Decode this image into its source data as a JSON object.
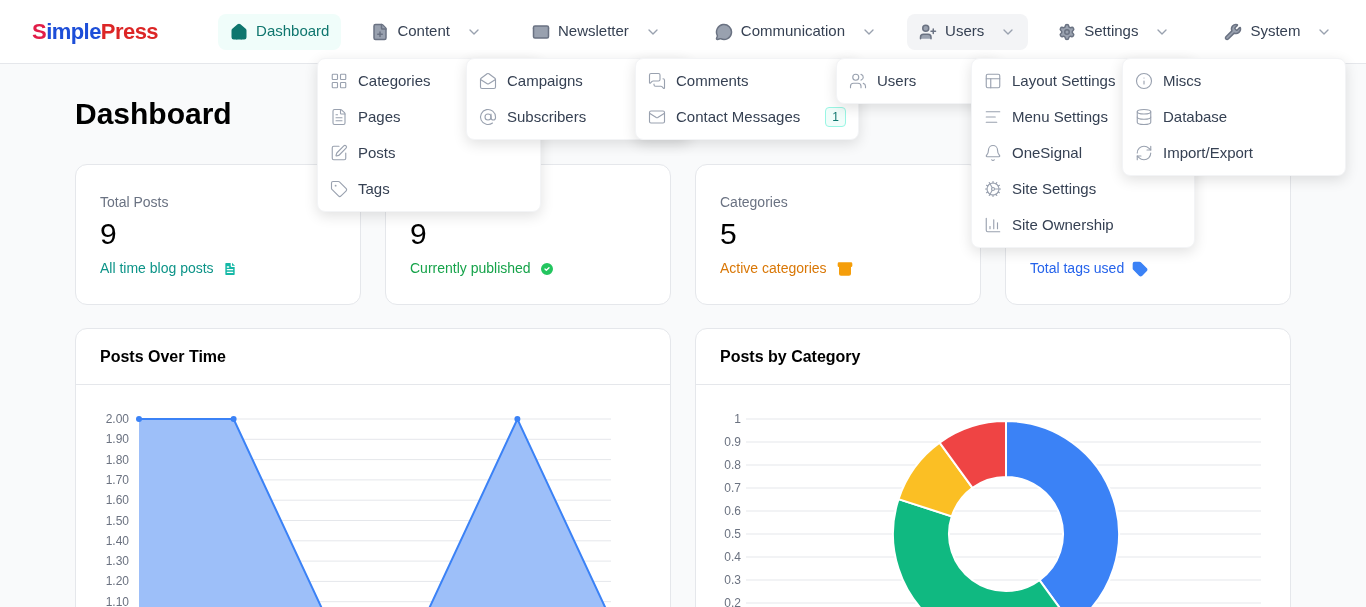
{
  "logo": [
    "S",
    "imple",
    "Press"
  ],
  "nav": [
    {
      "label": "Dashboard",
      "selected": true,
      "hovered": false
    },
    {
      "label": "Content",
      "selected": false,
      "hovered": false
    },
    {
      "label": "Newsletter",
      "selected": false,
      "hovered": false
    },
    {
      "label": "Communication",
      "selected": false,
      "hovered": false
    },
    {
      "label": "Users",
      "selected": false,
      "hovered": true
    },
    {
      "label": "Settings",
      "selected": false,
      "hovered": false
    },
    {
      "label": "System",
      "selected": false,
      "hovered": false
    }
  ],
  "menus": [
    {
      "items": [
        {
          "label": "Categories"
        },
        {
          "label": "Pages"
        },
        {
          "label": "Posts"
        },
        {
          "label": "Tags"
        }
      ]
    },
    {
      "items": [
        {
          "label": "Campaigns"
        },
        {
          "label": "Subscribers"
        }
      ]
    },
    {
      "items": [
        {
          "label": "Comments"
        },
        {
          "label": "Contact Messages",
          "badge": "1"
        }
      ]
    },
    {
      "items": [
        {
          "label": "Users"
        }
      ]
    },
    {
      "items": [
        {
          "label": "Layout Settings"
        },
        {
          "label": "Menu Settings"
        },
        {
          "label": "OneSignal"
        },
        {
          "label": "Site Settings"
        },
        {
          "label": "Site Ownership"
        }
      ]
    },
    {
      "items": [
        {
          "label": "Miscs"
        },
        {
          "label": "Database"
        },
        {
          "label": "Import/Export"
        }
      ]
    }
  ],
  "page_title": "Dashboard",
  "stats": [
    {
      "kind": "posts",
      "label": "Total Posts",
      "value": "9",
      "note": "All time blog posts"
    },
    {
      "kind": "published",
      "value": "9",
      "note": "Currently published"
    },
    {
      "kind": "categories",
      "label": "Categories",
      "value": "5",
      "note": "Active categories"
    },
    {
      "kind": "tags",
      "note": "Total tags used"
    }
  ],
  "line_chart": {
    "title": "Posts Over Time",
    "axis_labels": [
      "2.00",
      "1.90",
      "1.80",
      "1.70",
      "1.60",
      "1.50",
      "1.40",
      "1.30",
      "1.20",
      "1.10"
    ]
  },
  "donut_chart": {
    "title": "Posts by Category",
    "axis_labels": [
      "1",
      "0.9",
      "0.8",
      "0.7",
      "0.6",
      "0.5",
      "0.4",
      "0.3",
      "0.2"
    ]
  }
}
